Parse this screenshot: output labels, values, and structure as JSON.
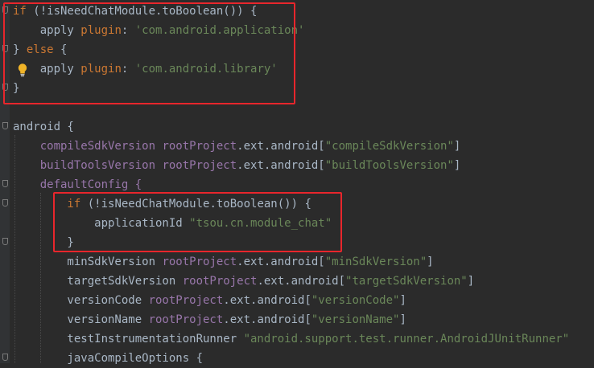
{
  "editor": {
    "lines": [
      [
        {
          "t": "if",
          "c": "kw"
        },
        {
          "t": " (!isNeedChatModule.toBoolean()) {",
          "c": "plain"
        }
      ],
      [
        {
          "t": "    apply ",
          "c": "plain"
        },
        {
          "t": "plugin",
          "c": "kw"
        },
        {
          "t": ": ",
          "c": "plain"
        },
        {
          "t": "'com.android.application'",
          "c": "str"
        }
      ],
      [
        {
          "t": "} ",
          "c": "plain"
        },
        {
          "t": "else",
          "c": "kw"
        },
        {
          "t": " {",
          "c": "plain"
        }
      ],
      [
        {
          "t": "    apply ",
          "c": "plain"
        },
        {
          "t": "plugin",
          "c": "kw"
        },
        {
          "t": ": ",
          "c": "plain"
        },
        {
          "t": "'com.android.library'",
          "c": "str"
        }
      ],
      [
        {
          "t": "}",
          "c": "plain"
        }
      ],
      [],
      [
        {
          "t": "android {",
          "c": "plain"
        }
      ],
      [
        {
          "t": "    compileSdkVersion ",
          "c": "ident"
        },
        {
          "t": "rootProject",
          "c": "ident"
        },
        {
          "t": ".ext.android[",
          "c": "plain"
        },
        {
          "t": "\"compileSdkVersion\"",
          "c": "str"
        },
        {
          "t": "]",
          "c": "plain"
        }
      ],
      [
        {
          "t": "    buildToolsVersion ",
          "c": "ident"
        },
        {
          "t": "rootProject",
          "c": "ident"
        },
        {
          "t": ".ext.android[",
          "c": "plain"
        },
        {
          "t": "\"buildToolsVersion\"",
          "c": "str"
        },
        {
          "t": "]",
          "c": "plain"
        }
      ],
      [
        {
          "t": "    defaultConfig {",
          "c": "ident"
        }
      ],
      [
        {
          "t": "        if",
          "c": "kw"
        },
        {
          "t": " (!isNeedChatModule.toBoolean()) {",
          "c": "plain"
        }
      ],
      [
        {
          "t": "            applicationId ",
          "c": "plain"
        },
        {
          "t": "\"tsou.cn.module_chat\"",
          "c": "str"
        }
      ],
      [
        {
          "t": "        }",
          "c": "plain"
        }
      ],
      [
        {
          "t": "        minSdkVersion ",
          "c": "plain"
        },
        {
          "t": "rootProject",
          "c": "ident"
        },
        {
          "t": ".ext.android[",
          "c": "plain"
        },
        {
          "t": "\"minSdkVersion\"",
          "c": "str"
        },
        {
          "t": "]",
          "c": "plain"
        }
      ],
      [
        {
          "t": "        targetSdkVersion ",
          "c": "plain"
        },
        {
          "t": "rootProject",
          "c": "ident"
        },
        {
          "t": ".ext.android[",
          "c": "plain"
        },
        {
          "t": "\"targetSdkVersion\"",
          "c": "str"
        },
        {
          "t": "]",
          "c": "plain"
        }
      ],
      [
        {
          "t": "        versionCode ",
          "c": "plain"
        },
        {
          "t": "rootProject",
          "c": "ident"
        },
        {
          "t": ".ext.android[",
          "c": "plain"
        },
        {
          "t": "\"versionCode\"",
          "c": "str"
        },
        {
          "t": "]",
          "c": "plain"
        }
      ],
      [
        {
          "t": "        versionName ",
          "c": "plain"
        },
        {
          "t": "rootProject",
          "c": "ident"
        },
        {
          "t": ".ext.android[",
          "c": "plain"
        },
        {
          "t": "\"versionName\"",
          "c": "str"
        },
        {
          "t": "]",
          "c": "plain"
        }
      ],
      [
        {
          "t": "        testInstrumentationRunner ",
          "c": "plain"
        },
        {
          "t": "\"android.support.test.runner.AndroidJUnitRunner\"",
          "c": "str"
        }
      ],
      [
        {
          "t": "        javaCompileOptions {",
          "c": "plain"
        }
      ]
    ],
    "highlight_color": "#e8262c",
    "bulb_icon": "lightbulb-icon"
  }
}
